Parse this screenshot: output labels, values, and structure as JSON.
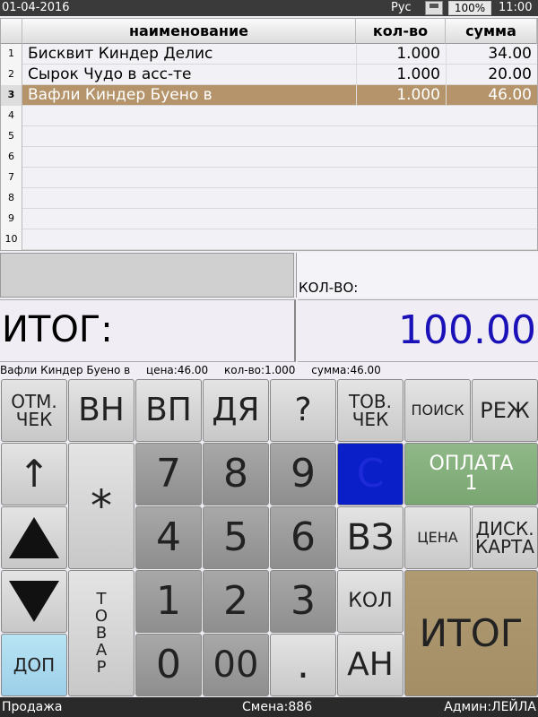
{
  "status": {
    "date": "01-04-2016",
    "lang": "Рус",
    "battery": "100%",
    "time": "11:00"
  },
  "table": {
    "headers": {
      "name": "наименование",
      "qty": "кол-во",
      "sum": "сумма"
    },
    "rows": [
      {
        "n": "1",
        "name": "Бисквит Киндер Делис",
        "qty": "1.000",
        "sum": "34.00"
      },
      {
        "n": "2",
        "name": "Сырок Чудо в асс-те",
        "qty": "1.000",
        "sum": "20.00"
      },
      {
        "n": "3",
        "name": "Вафли Киндер Буено в",
        "qty": "1.000",
        "sum": "46.00"
      },
      {
        "n": "4",
        "name": "",
        "qty": "",
        "sum": ""
      },
      {
        "n": "5",
        "name": "",
        "qty": "",
        "sum": ""
      },
      {
        "n": "6",
        "name": "",
        "qty": "",
        "sum": ""
      },
      {
        "n": "7",
        "name": "",
        "qty": "",
        "sum": ""
      },
      {
        "n": "8",
        "name": "",
        "qty": "",
        "sum": ""
      },
      {
        "n": "9",
        "name": "",
        "qty": "",
        "sum": ""
      },
      {
        "n": "10",
        "name": "",
        "qty": "",
        "sum": ""
      }
    ]
  },
  "qty_label": "КОЛ-ВО:",
  "total": {
    "label": "ИТОГ:",
    "value": "100.00"
  },
  "item_info": {
    "name": "Вафли Киндер Буено в",
    "price": "цена:46.00",
    "qty": "кол-во:1.000",
    "sum": "сумма:46.00"
  },
  "keys": {
    "cancel_check": "ОТМ.\nЧЕК",
    "vn": "ВН",
    "vp": "ВП",
    "dya": "ДЯ",
    "question": "?",
    "tov_check": "ТОВ.\nЧЕК",
    "search": "ПОИСК",
    "mode": "РЕЖ",
    "up_arrow": "↑",
    "star": "*",
    "seven": "7",
    "eight": "8",
    "nine": "9",
    "clear": "С",
    "payment": "ОПЛАТА\n1",
    "four": "4",
    "five": "5",
    "six": "6",
    "return": "ВЗ",
    "price": "ЦЕНА",
    "disc_card": "ДИСК.\nКАРТА",
    "product": "Т\nО\nВ\nА\nР",
    "one": "1",
    "two": "2",
    "three": "3",
    "qty": "КОЛ",
    "total": "ИТОГ",
    "dop": "ДОП",
    "zero": "0",
    "double_zero": "00",
    "dot": ".",
    "an": "АН"
  },
  "colors": {
    "selected_row": "#b5946c",
    "total_value": "#1a12b8",
    "clear_key": "#0a1fc8",
    "pay_key": "#7aa672",
    "total_key": "#a48e66"
  },
  "bottom": {
    "mode": "Продажа",
    "shift": "Смена:886",
    "user": "Админ:ЛЕЙЛА"
  }
}
